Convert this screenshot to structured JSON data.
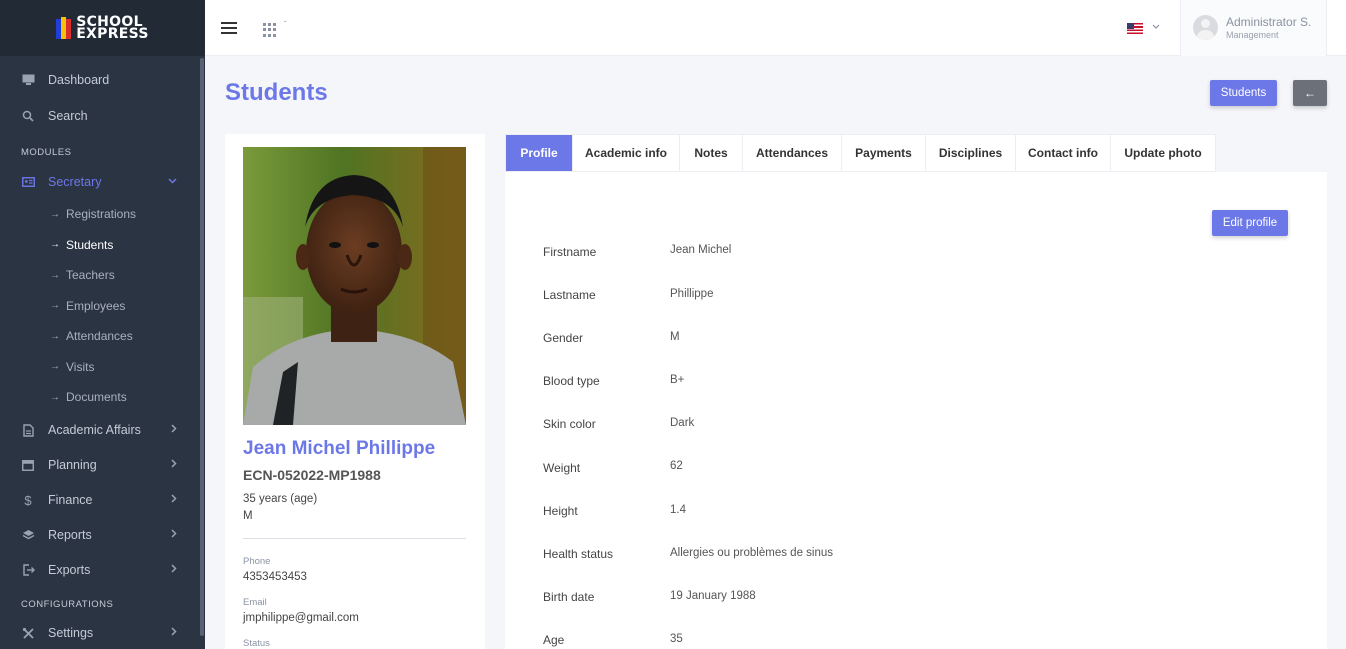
{
  "brand": {
    "line1": "SCHOOL",
    "line2": "EXPRESS"
  },
  "sidebar": {
    "top_items": [
      {
        "label": "Dashboard",
        "icon": "monitor-icon"
      },
      {
        "label": "Search",
        "icon": "search-icon"
      }
    ],
    "modules_title": "MODULES",
    "secretary": {
      "label": "Secretary",
      "icon": "id-card-icon"
    },
    "secretary_items": [
      "Registrations",
      "Students",
      "Teachers",
      "Employees",
      "Attendances",
      "Visits",
      "Documents"
    ],
    "module_items": [
      {
        "label": "Academic Affairs",
        "icon": "file-icon"
      },
      {
        "label": "Planning",
        "icon": "calendar-icon"
      },
      {
        "label": "Finance",
        "icon": "dollar-icon"
      },
      {
        "label": "Reports",
        "icon": "layers-icon"
      },
      {
        "label": "Exports",
        "icon": "export-icon"
      }
    ],
    "config_title": "CONFIGURATIONS",
    "settings": {
      "label": "Settings",
      "icon": "tools-icon"
    }
  },
  "header": {
    "user_name": "Administrator S.",
    "user_role": "Management",
    "language_flag": "us-flag-icon"
  },
  "page": {
    "title": "Students",
    "students_button": "Students",
    "back_icon": "←"
  },
  "student": {
    "name": "Jean Michel Phillippe",
    "code": "ECN-052022-MP1988",
    "age": "35 years (age)",
    "gender": "M",
    "phone_label": "Phone",
    "phone": "4353453453",
    "email_label": "Email",
    "email": "jmphilippe@gmail.com",
    "status_label": "Status"
  },
  "tabs": [
    "Profile",
    "Academic info",
    "Notes",
    "Attendances",
    "Payments",
    "Disciplines",
    "Contact info",
    "Update photo"
  ],
  "profile": {
    "edit_button": "Edit profile",
    "fields": [
      {
        "label": "Firstname",
        "value": "Jean Michel"
      },
      {
        "label": "Lastname",
        "value": "Phillippe"
      },
      {
        "label": "Gender",
        "value": "M"
      },
      {
        "label": "Blood type",
        "value": "B+"
      },
      {
        "label": "Skin color",
        "value": "Dark"
      },
      {
        "label": "Weight",
        "value": "62"
      },
      {
        "label": "Height",
        "value": "1.4"
      },
      {
        "label": "Health status",
        "value": "Allergies ou problèmes de sinus"
      },
      {
        "label": "Birth date",
        "value": "19 January 1988"
      },
      {
        "label": "Age",
        "value": "35"
      }
    ]
  },
  "colors": {
    "accent": "#6d78e8",
    "sidebar": "#2b3442",
    "back_button": "#6c7079"
  }
}
